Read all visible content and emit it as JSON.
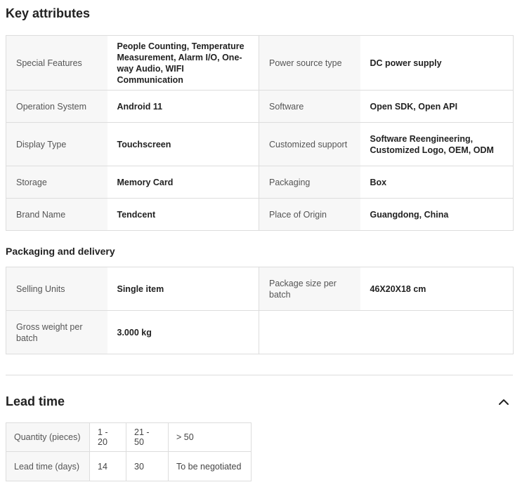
{
  "key_attributes": {
    "title": "Key attributes",
    "rows": [
      [
        {
          "key": "Special Features",
          "value": "People Counting, Temperature Measurement, Alarm I/O, One-way Audio, WIFI Communication"
        },
        {
          "key": "Power source type",
          "value": "DC power supply"
        }
      ],
      [
        {
          "key": "Operation System",
          "value": "Android 11"
        },
        {
          "key": "Software",
          "value": "Open SDK, Open API"
        }
      ],
      [
        {
          "key": "Display Type",
          "value": "Touchscreen"
        },
        {
          "key": "Customized support",
          "value": "Software Reengineering, Customized Logo, OEM, ODM"
        }
      ],
      [
        {
          "key": "Storage",
          "value": "Memory Card"
        },
        {
          "key": "Packaging",
          "value": "Box"
        }
      ],
      [
        {
          "key": "Brand Name",
          "value": "Tendcent"
        },
        {
          "key": "Place of Origin",
          "value": "Guangdong, China"
        }
      ]
    ]
  },
  "packaging": {
    "title": "Packaging and delivery",
    "rows": [
      [
        {
          "key": "Selling Units",
          "value": "Single item"
        },
        {
          "key": "Package size per batch",
          "value": "46X20X18 cm"
        }
      ],
      [
        {
          "key": "Gross weight per batch",
          "value": "3.000 kg"
        }
      ]
    ]
  },
  "lead_time": {
    "title": "Lead time",
    "toggle_icon": "chevron-up-icon",
    "quantity_label": "Quantity (pieces)",
    "lead_label": "Lead time (days)",
    "quantities": [
      "1 - 20",
      "21 - 50",
      "> 50"
    ],
    "days": [
      "14",
      "30",
      "To be negotiated"
    ]
  }
}
